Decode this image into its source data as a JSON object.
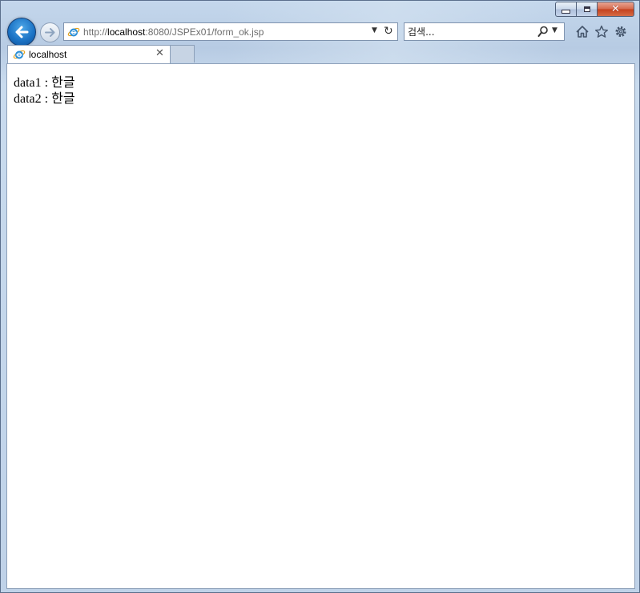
{
  "address_bar": {
    "url_prefix": "http://",
    "url_host": "localhost",
    "url_rest": ":8080/JSPEx01/form_ok.jsp"
  },
  "search": {
    "placeholder": "검색..."
  },
  "tab": {
    "title": "localhost"
  },
  "page": {
    "lines": [
      "data1 : 한글",
      "data2 : 한글"
    ]
  },
  "icons": {
    "back": "back-arrow-icon",
    "forward": "forward-arrow-icon",
    "ie": "internet-explorer-icon",
    "refresh": "refresh-icon",
    "search": "search-icon",
    "home": "home-icon",
    "favorites": "star-icon",
    "tools": "gear-icon",
    "close_tab": "close-icon"
  },
  "colors": {
    "accent": "#1c74c6",
    "close_button": "#c4401d",
    "frame": "#c4d7ec"
  }
}
